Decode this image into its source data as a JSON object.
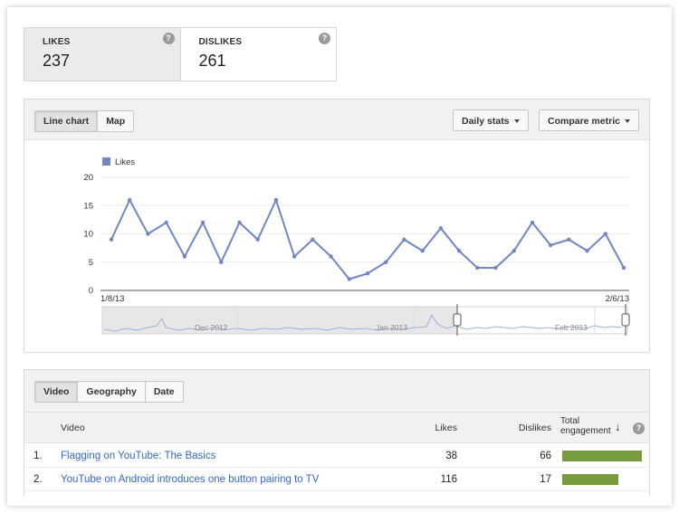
{
  "metrics": [
    {
      "label": "LIKES",
      "value": "237"
    },
    {
      "label": "DISLIKES",
      "value": "261"
    }
  ],
  "help_glyph": "?",
  "chart_panel": {
    "view_tabs": [
      "Line chart",
      "Map"
    ],
    "daily_stats": "Daily stats",
    "compare_metric": "Compare metric"
  },
  "chart_data": {
    "type": "line",
    "title": "",
    "series": [
      {
        "name": "Likes",
        "color": "#7086c6",
        "values": [
          9,
          16,
          10,
          12,
          6,
          12,
          5,
          12,
          9,
          16,
          6,
          9,
          6,
          2,
          3,
          5,
          9,
          7,
          11,
          7,
          4,
          4,
          7,
          12,
          8,
          9,
          7,
          10,
          4
        ]
      }
    ],
    "x_start_label": "1/8/13",
    "x_end_label": "2/6/13",
    "ylim": [
      0,
      20
    ],
    "y_ticks": [
      "0",
      "5",
      "10",
      "15",
      "20"
    ],
    "grid": true,
    "legend": "top-left"
  },
  "timeline": {
    "labels": [
      "Dec 2012",
      "Jan 2013",
      "Feb 2013"
    ]
  },
  "table_panel": {
    "tabs": [
      "Video",
      "Geography",
      "Date"
    ],
    "columns": {
      "video": "Video",
      "likes": "Likes",
      "dislikes": "Dislikes",
      "engagement": "Total engagement"
    },
    "sort_glyph": "↓",
    "rows": [
      {
        "rank": "1.",
        "title": "Flagging on YouTube: The Basics",
        "likes": "38",
        "dislikes": "66",
        "engagement_share": 1.0
      },
      {
        "rank": "2.",
        "title": "YouTube on Android introduces one button pairing to TV",
        "likes": "116",
        "dislikes": "17",
        "engagement_share": 0.7
      }
    ]
  },
  "colors": {
    "line": "#7086c6",
    "bar": "#779b3d"
  }
}
